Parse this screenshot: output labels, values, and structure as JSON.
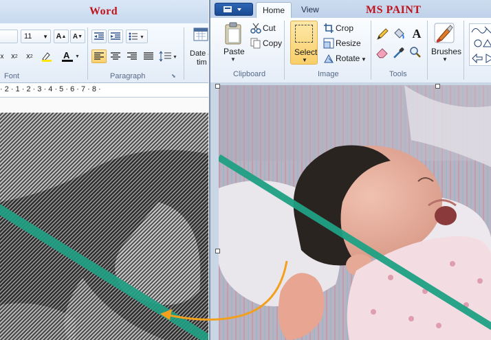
{
  "word": {
    "title": "Word",
    "font_size_value": "11",
    "groups": {
      "font": "Font",
      "paragraph": "Paragraph"
    },
    "buttons": {
      "date_time": "Date &",
      "date_time_2": "tim"
    },
    "ruler": "· 2 · 1 · 2 · 3 · 4 · 5 · 6 · 7 · 8 ·"
  },
  "paint": {
    "title": "MS PAINT",
    "tabs": {
      "home": "Home",
      "view": "View"
    },
    "clipboard": {
      "paste": "Paste",
      "cut": "Cut",
      "copy": "Copy",
      "group": "Clipboard"
    },
    "image": {
      "select": "Select",
      "crop": "Crop",
      "resize": "Resize",
      "rotate": "Rotate",
      "group": "Image"
    },
    "tools": {
      "group": "Tools",
      "brushes": "Brushes"
    }
  },
  "colors": {
    "title_red": "#c0121b",
    "annotation_line": "#1fa184",
    "annotation_arrow": "#f2a01e",
    "selected_button": "#f9cf6a"
  }
}
